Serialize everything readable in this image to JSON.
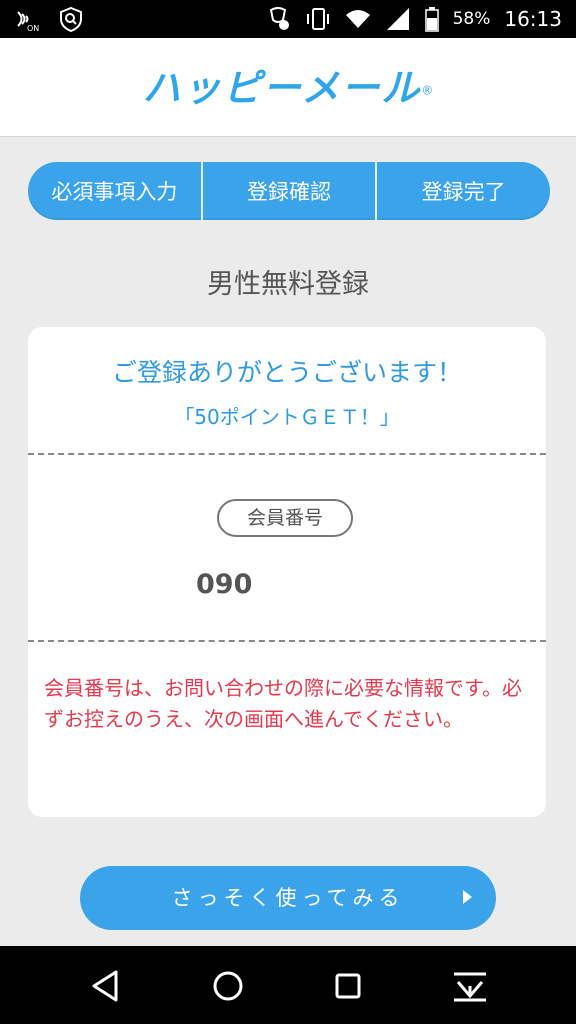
{
  "status_bar": {
    "battery_percent": "58%",
    "time": "16:13",
    "nfc_label": "ON",
    "icons": [
      "nfc-icon",
      "shield-search-icon",
      "notification-icon",
      "vibrate-icon",
      "wifi-icon",
      "signal-icon",
      "battery-icon"
    ]
  },
  "header": {
    "logo_text": "ハッピーメール",
    "logo_mark": "®"
  },
  "steps": [
    {
      "label": "必須事項入力"
    },
    {
      "label": "登録確認"
    },
    {
      "label": "登録完了"
    }
  ],
  "page": {
    "title": "男性無料登録"
  },
  "card": {
    "thanks": "ご登録ありがとうございます！",
    "points": "「50ポイントＧＥＴ！」",
    "member_label": "会員番号",
    "member_number": "090",
    "notice": "会員番号は、お問い合わせの際に必要な情報です。必ずお控えのうえ、次の画面へ進んでください。"
  },
  "cta": {
    "label": "さっそく使ってみる",
    "arrow_icon": "triangle-right-icon"
  },
  "navbar": {
    "icons": [
      "back-icon",
      "home-icon",
      "recents-icon",
      "download-icon"
    ]
  },
  "colors": {
    "accent": "#3aa3ea",
    "notice": "#e53a4d",
    "background": "#ebebeb"
  }
}
